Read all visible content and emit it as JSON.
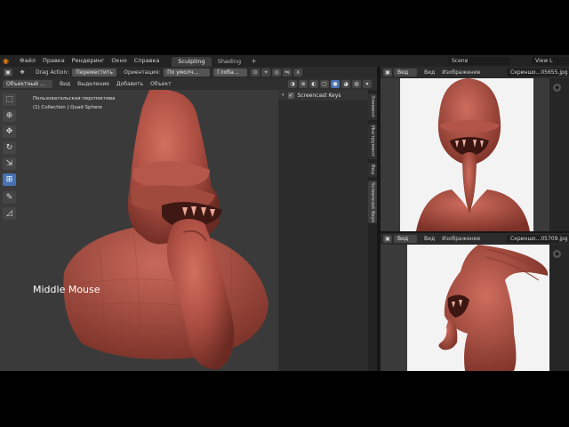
{
  "topbar": {
    "menu": [
      "Файл",
      "Правка",
      "Рендеринг",
      "Окно",
      "Справка"
    ],
    "workspaces": [
      "Sculpting",
      "Shading"
    ],
    "active_workspace": "Sculpting",
    "add_label": "+",
    "scene": "Scene",
    "view_layer": "View L"
  },
  "toolheader": {
    "drag_action_label": "Drag Action:",
    "drag_action_value": "Переместить",
    "orientation_label": "Ориентация:",
    "orientation_value": "По умолч…",
    "transform_value": "Глоба…"
  },
  "viewport_header": {
    "mode": "Объектный …",
    "items": [
      "Вид",
      "Выделение",
      "Добавить",
      "Объект"
    ]
  },
  "viewport": {
    "perspective": "Пользовательская перспектива",
    "collection": "(1) Collection | Quad Sphere",
    "overlay_text": "Middle Mouse"
  },
  "npanel": {
    "header": "Screencast Keys",
    "tabs": [
      "Элемент",
      "Инструмент",
      "Вид",
      "Screencast Keys"
    ]
  },
  "image_editor_top": {
    "view": "Вид",
    "menu": [
      "Вид",
      "Изображение"
    ],
    "image_name": "Скриншо...05655.jpg"
  },
  "image_editor_bottom": {
    "view": "Вид",
    "menu": [
      "Вид",
      "Изображение"
    ],
    "image_name": "Скриншо...05709.jpg"
  },
  "colors": {
    "accent": "#4772b3",
    "sculpt_clay": "#b25548",
    "background": "#3a3a3a"
  }
}
